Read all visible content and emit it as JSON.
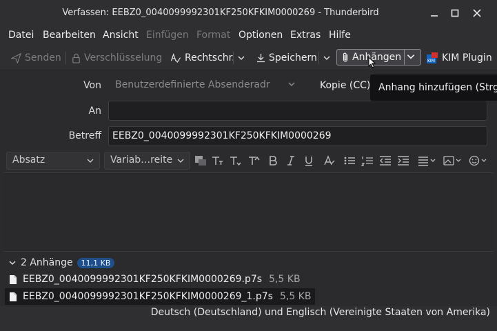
{
  "window": {
    "title": "Verfassen: EEBZ0_0040099992301KF250KFKIM0000269 - Thunderbird"
  },
  "menubar": {
    "items": [
      {
        "label": "Datei",
        "disabled": false
      },
      {
        "label": "Bearbeiten",
        "disabled": false
      },
      {
        "label": "Ansicht",
        "disabled": false
      },
      {
        "label": "Einfügen",
        "disabled": true
      },
      {
        "label": "Format",
        "disabled": true
      },
      {
        "label": "Optionen",
        "disabled": false
      },
      {
        "label": "Extras",
        "disabled": false
      },
      {
        "label": "Hilfe",
        "disabled": false
      }
    ]
  },
  "toolbar": {
    "send": "Senden",
    "encryption": "Verschlüsselung",
    "spellcheck": "Rechtschr.",
    "save": "Speichern",
    "attach": "Anhängen",
    "kim": "KIM Plugin",
    "kim_icon_text": "KIM"
  },
  "tooltip": "Anhang hinzufügen (Strg+Umschalt+A)",
  "header": {
    "from_label": "Von",
    "from_value": "Benutzerdefinierte Absenderadr",
    "cc_label": "Kopie (CC)",
    "to_label": "An",
    "to_value": "",
    "subject_label": "Betreff",
    "subject_value": "EEBZ0_0040099992301KF250KFKIM0000269"
  },
  "format_toolbar": {
    "paragraph": "Absatz",
    "font": "Variab…reite"
  },
  "attachments": {
    "summary": "2 Anhänge",
    "total_size": "11,1 KB",
    "files": [
      {
        "name": "EEBZ0_0040099992301KF250KFKIM0000269.p7s",
        "size": "5,5 KB",
        "selected": false
      },
      {
        "name": "EEBZ0_0040099992301KF250KFKIM0000269_1.p7s",
        "size": "5,5 KB",
        "selected": true
      }
    ]
  },
  "statusbar": {
    "language": "Deutsch (Deutschland) und Englisch (Vereinigte Staaten von Amerika)"
  },
  "colors": {
    "background": "#2b2b2e",
    "badge": "#1f4f8a",
    "accent_border": "#8a8a8e"
  }
}
